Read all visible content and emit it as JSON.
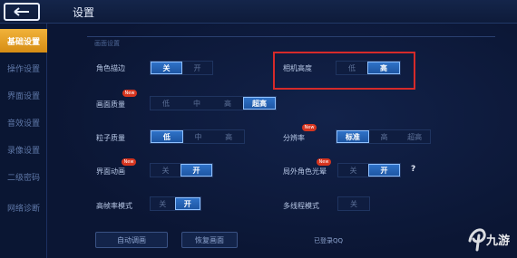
{
  "header": {
    "title": "设置"
  },
  "sidebar": {
    "items": [
      {
        "label": "基础设置",
        "active": true
      },
      {
        "label": "操作设置",
        "active": false
      },
      {
        "label": "界面设置",
        "active": false
      },
      {
        "label": "音效设置",
        "active": false
      },
      {
        "label": "录像设置",
        "active": false
      },
      {
        "label": "二级密码",
        "active": false
      },
      {
        "label": "网络诊断",
        "active": false
      }
    ]
  },
  "section": {
    "title": "画面设置"
  },
  "settings": {
    "edge": {
      "label": "角色描边",
      "options": [
        "关",
        "开"
      ],
      "selected": "关"
    },
    "camera": {
      "label": "相机高度",
      "options": [
        "低",
        "高"
      ],
      "selected": "高"
    },
    "quality": {
      "label": "画面质量",
      "badge": "New",
      "options": [
        "低",
        "中",
        "高",
        "超高"
      ],
      "selected": "超高"
    },
    "particle": {
      "label": "粒子质量",
      "options": [
        "低",
        "中",
        "高"
      ],
      "selected": "低"
    },
    "resolution": {
      "label": "分辨率",
      "badge": "New",
      "options": [
        "标准",
        "高",
        "超高"
      ],
      "selected": "标准"
    },
    "ui_anim": {
      "label": "界面动画",
      "badge": "New",
      "options": [
        "关",
        "开"
      ],
      "selected": "开"
    },
    "outline": {
      "label": "局外角色光晕",
      "badge": "New",
      "options": [
        "关",
        "开"
      ],
      "selected": "开",
      "help": "?"
    },
    "hfr": {
      "label": "高帧率模式",
      "options": [
        "关",
        "开"
      ],
      "selected": "开"
    },
    "multithread": {
      "label": "多线程模式",
      "options": [
        "关"
      ],
      "selected": ""
    }
  },
  "footer": {
    "auto_adjust": "自动调画",
    "restore_default": "恢复画面",
    "login_status": "已登录QQ"
  },
  "watermark": {
    "text": "九游"
  },
  "colors": {
    "accent": "#f1b23a",
    "selected": "#2f72c8",
    "highlight": "#d52a2a"
  }
}
